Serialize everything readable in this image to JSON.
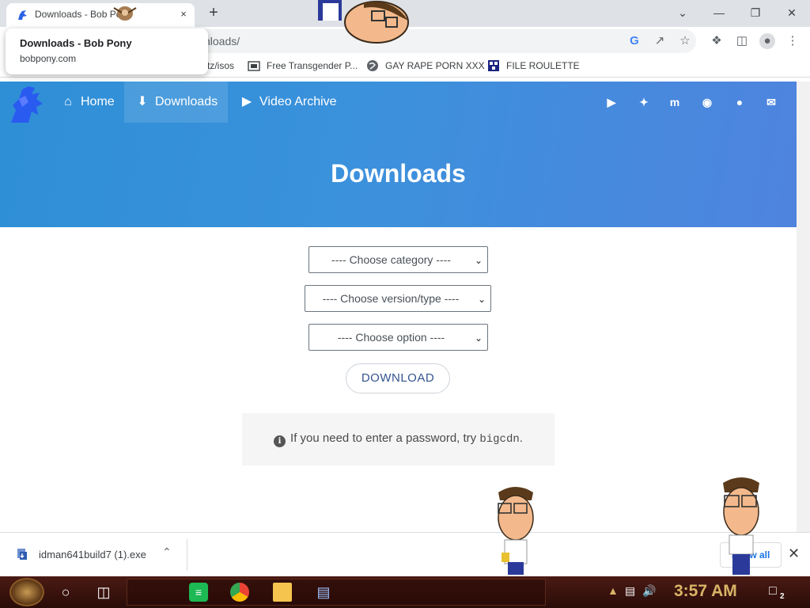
{
  "browser": {
    "tab_title": "Downloads - Bob Pony",
    "tab_close": "×",
    "new_tab": "+",
    "url_fragment": "nloads/",
    "hovercard": {
      "title": "Downloads - Bob Pony",
      "domain": "bobpony.com"
    },
    "bookmarks": [
      {
        "label": "tz/isos"
      },
      {
        "label": "Free Transgender P..."
      },
      {
        "label": "GAY RAPE PORN XXX"
      },
      {
        "label": "FILE ROULETTE"
      }
    ]
  },
  "site": {
    "nav": {
      "home": "Home",
      "downloads": "Downloads",
      "video_archive": "Video Archive"
    },
    "social_icons": [
      "youtube-icon",
      "twitter-icon",
      "mastodon-icon",
      "discord-icon",
      "github-icon",
      "mail-icon"
    ],
    "hero_title": "Downloads",
    "selects": {
      "category": "---- Choose category ----",
      "version": "---- Choose version/type ----",
      "option": "---- Choose option ----"
    },
    "download_button": "DOWNLOAD",
    "note_prefix": "If you need to enter a password, try ",
    "note_code": "bigcdn",
    "note_suffix": "."
  },
  "shelf": {
    "filename": "idman641build7 (1).exe",
    "show_all": "Show all"
  },
  "taskbar": {
    "clock": "3:57 AM",
    "notification_count": "2"
  },
  "colors": {
    "hero_start": "#2e8fd6",
    "hero_end": "#4f84de",
    "button_text": "#34548f",
    "clock": "#d9b466"
  }
}
